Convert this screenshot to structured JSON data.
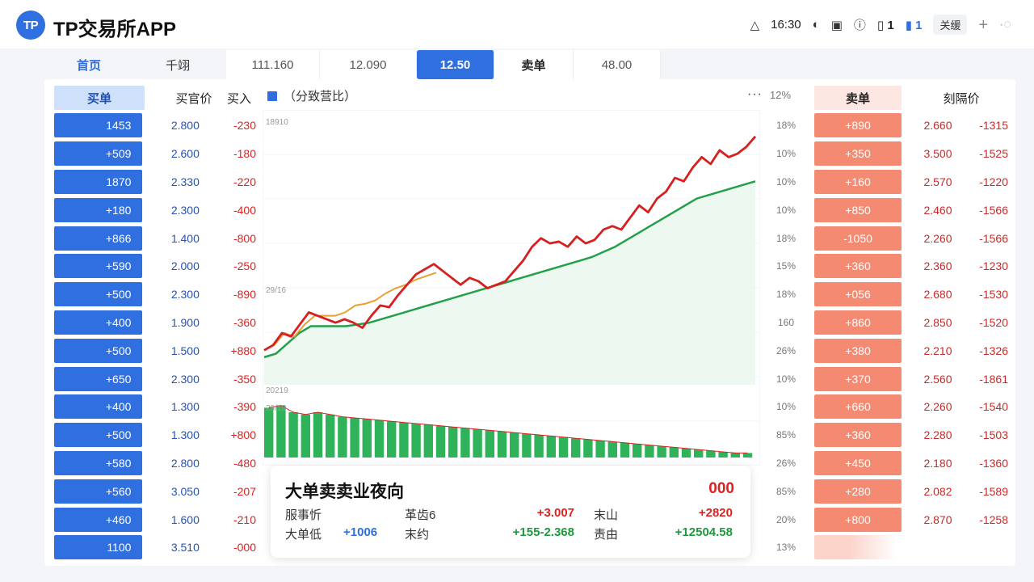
{
  "header": {
    "logo_text": "TP",
    "title": "TP交易所APP",
    "time": "16:30",
    "sim1": "1",
    "sim2": "1",
    "close_label": "关缓",
    "plus": "+",
    "dots": "·◌"
  },
  "tabs": [
    {
      "label": "首页"
    },
    {
      "label": "千翊"
    },
    {
      "label": "111.160"
    },
    {
      "label": "12.090"
    },
    {
      "label": "12.50"
    },
    {
      "label": "卖单"
    },
    {
      "label": "48.00"
    }
  ],
  "left_book": {
    "headers": {
      "buy": "买单",
      "price": "买官价",
      "change": "买入"
    },
    "rows": [
      {
        "vol": "1453",
        "price": "2.800",
        "chg": "-230"
      },
      {
        "vol": "+509",
        "price": "2.600",
        "chg": "-180"
      },
      {
        "vol": "1870",
        "price": "2.330",
        "chg": "-220"
      },
      {
        "vol": "+180",
        "price": "2.300",
        "chg": "-400"
      },
      {
        "vol": "+866",
        "price": "1.400",
        "chg": "-800"
      },
      {
        "vol": "+590",
        "price": "2.000",
        "chg": "-250"
      },
      {
        "vol": "+500",
        "price": "2.300",
        "chg": "-890"
      },
      {
        "vol": "+400",
        "price": "1.900",
        "chg": "-360"
      },
      {
        "vol": "+500",
        "price": "1.500",
        "chg": "+880"
      },
      {
        "vol": "+650",
        "price": "2.300",
        "chg": "-350"
      },
      {
        "vol": "+400",
        "price": "1.300",
        "chg": "-390"
      },
      {
        "vol": "+500",
        "price": "1.300",
        "chg": "+800"
      },
      {
        "vol": "+580",
        "price": "2.800",
        "chg": "-480"
      },
      {
        "vol": "+560",
        "price": "3.050",
        "chg": "-207"
      },
      {
        "vol": "+460",
        "price": "1.600",
        "chg": "-210"
      },
      {
        "vol": "1100",
        "price": "3.510",
        "chg": "-000"
      }
    ]
  },
  "chart": {
    "legend": "（分致营比）",
    "more": "···",
    "pct_header": "12%",
    "label_top": "18910",
    "label_mid": "29/16",
    "label_low1": "20219",
    "label_low2": "29/18",
    "pct_col": [
      "18%",
      "10%",
      "10%",
      "10%",
      "18%",
      "15%",
      "18%",
      "160",
      "26%",
      "10%",
      "10%",
      "85%",
      "26%",
      "85%",
      "20%",
      "13%"
    ]
  },
  "chart_data": {
    "type": "line",
    "series": [
      {
        "values": [
          20,
          23,
          30,
          28,
          35,
          42,
          40,
          38,
          36,
          38,
          36,
          33,
          40,
          46,
          45,
          52,
          58,
          64,
          67,
          70,
          66,
          62,
          58,
          62,
          60,
          56,
          58,
          60,
          66,
          72,
          80,
          85,
          82,
          83,
          80,
          86,
          82,
          84,
          90,
          92,
          90,
          97,
          104,
          100,
          108,
          112,
          120,
          118,
          126,
          132,
          128,
          136,
          132,
          134,
          138,
          144
        ]
      },
      {
        "values": [
          20,
          23,
          30,
          28,
          35,
          40,
          40,
          40,
          42,
          46,
          47,
          49,
          53,
          56,
          58,
          61,
          63,
          65
        ]
      },
      {
        "values": [
          16,
          18,
          24,
          30,
          34,
          34,
          34,
          34,
          35,
          36,
          38,
          40,
          42,
          44,
          46,
          48,
          50,
          52,
          54,
          56,
          58,
          60,
          62,
          64,
          66,
          68,
          70,
          72,
          74,
          77,
          80,
          84,
          88,
          92,
          96,
          100,
          104,
          108,
          110,
          112,
          114,
          116,
          118
        ]
      },
      {
        "values": [
          44,
          46,
          40,
          38,
          40,
          38,
          36,
          35,
          34,
          33,
          32,
          31,
          30,
          29,
          28,
          27,
          26,
          25,
          24,
          23,
          22,
          21,
          20,
          19,
          18,
          17,
          16,
          15,
          14,
          13,
          12,
          11,
          10,
          9,
          8,
          7,
          6,
          5,
          4,
          4
        ]
      }
    ]
  },
  "right_book": {
    "headers": {
      "sell": "卖单",
      "price": "刻隔价"
    },
    "rows": [
      {
        "vol": "+890",
        "price": "2.660",
        "chg": "-1315"
      },
      {
        "vol": "+350",
        "price": "3.500",
        "chg": "-1525"
      },
      {
        "vol": "+160",
        "price": "2.570",
        "chg": "-1220"
      },
      {
        "vol": "+850",
        "price": "2.460",
        "chg": "-1566"
      },
      {
        "vol": "-1050",
        "price": "2.260",
        "chg": "-1566"
      },
      {
        "vol": "+360",
        "price": "2.360",
        "chg": "-1230"
      },
      {
        "vol": "+056",
        "price": "2.680",
        "chg": "-1530"
      },
      {
        "vol": "+860",
        "price": "2.850",
        "chg": "-1520"
      },
      {
        "vol": "+380",
        "price": "2.210",
        "chg": "-1326"
      },
      {
        "vol": "+370",
        "price": "2.560",
        "chg": "-1861"
      },
      {
        "vol": "+660",
        "price": "2.260",
        "chg": "-1540"
      },
      {
        "vol": "+360",
        "price": "2.280",
        "chg": "-1503"
      },
      {
        "vol": "+450",
        "price": "2.180",
        "chg": "-1360"
      },
      {
        "vol": "+280",
        "price": "2.082",
        "chg": "-1589"
      },
      {
        "vol": "+800",
        "price": "2.870",
        "chg": "-1258"
      },
      {
        "vol": "",
        "price": "",
        "chg": ""
      }
    ]
  },
  "card": {
    "title": "大单卖卖业夜向",
    "code": "000",
    "row1": {
      "l1": "服事忻",
      "v1": "",
      "l2": "革齿6",
      "v2": "+3.007",
      "l3": "末山",
      "v3": "+2820"
    },
    "row2": {
      "l1": "大单低",
      "v1": "+1006",
      "l2": "末约",
      "v2": "+155-2.368",
      "l3": "责由",
      "v3": "+12504.58"
    }
  },
  "colors": {
    "accent": "#2f6fe0",
    "buy_bar": "#2f6fe0",
    "sell_bar": "#f58a72",
    "price_line": "#d62020",
    "avg_line": "#e8a030",
    "trend_line": "#22a04a",
    "volume_bar": "#2fb35a"
  }
}
